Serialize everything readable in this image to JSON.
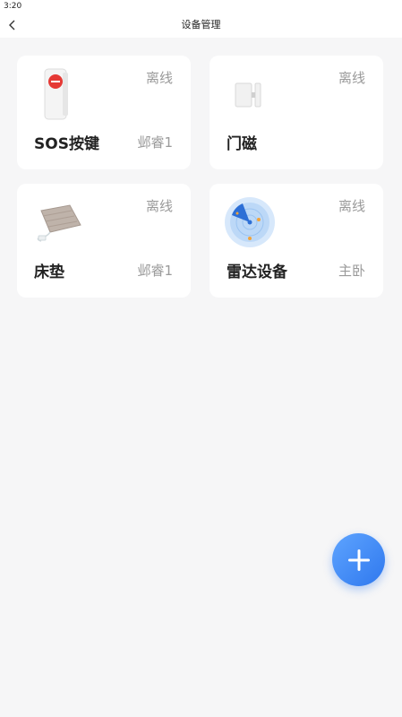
{
  "status_bar": {
    "time": "3:20"
  },
  "header": {
    "title": "设备管理",
    "back_icon": "chevron-left-icon"
  },
  "devices": [
    {
      "name": "SOS按键",
      "status": "离线",
      "location": "邺睿1",
      "icon": "sos-button-icon"
    },
    {
      "name": "门磁",
      "status": "离线",
      "location": "",
      "icon": "door-sensor-icon"
    },
    {
      "name": "床垫",
      "status": "离线",
      "location": "邺睿1",
      "icon": "mattress-icon"
    },
    {
      "name": "雷达设备",
      "status": "离线",
      "location": "主卧",
      "icon": "radar-icon"
    }
  ],
  "fab": {
    "icon": "plus-icon"
  },
  "colors": {
    "accent": "#3a86f5",
    "muted_text": "#9a9a9a",
    "background": "#f6f6f7"
  }
}
